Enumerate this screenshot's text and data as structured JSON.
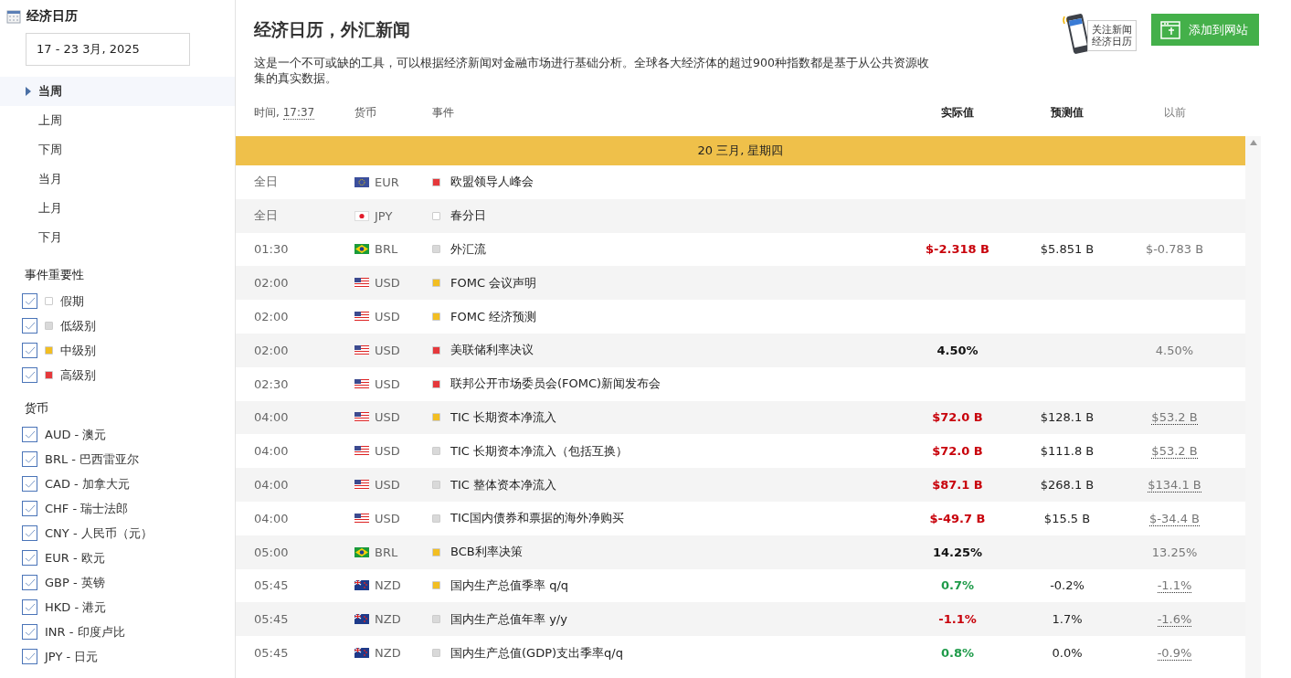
{
  "sidebar": {
    "title": "经济日历",
    "date_range": "17  - 23 3月, 2025",
    "periods": [
      {
        "label": "当周",
        "selected": true
      },
      {
        "label": "上周",
        "selected": false
      },
      {
        "label": "下周",
        "selected": false
      },
      {
        "label": "当月",
        "selected": false
      },
      {
        "label": "上月",
        "selected": false
      },
      {
        "label": "下月",
        "selected": false
      }
    ],
    "importance_title": "事件重要性",
    "importance": [
      {
        "label": "假期",
        "checked": true,
        "color": "#ffffff"
      },
      {
        "label": "低级别",
        "checked": true,
        "color": "#d9d9d9"
      },
      {
        "label": "中级别",
        "checked": true,
        "color": "#f2be22"
      },
      {
        "label": "高级别",
        "checked": true,
        "color": "#e5383b"
      }
    ],
    "currency_title": "货币",
    "currencies": [
      {
        "label": "AUD - 澳元",
        "checked": true
      },
      {
        "label": "BRL - 巴西雷亚尔",
        "checked": true
      },
      {
        "label": "CAD - 加拿大元",
        "checked": true
      },
      {
        "label": "CHF - 瑞士法郎",
        "checked": true
      },
      {
        "label": "CNY - 人民币（元）",
        "checked": true
      },
      {
        "label": "EUR - 欧元",
        "checked": true
      },
      {
        "label": "GBP - 英镑",
        "checked": true
      },
      {
        "label": "HKD - 港元",
        "checked": true
      },
      {
        "label": "INR - 印度卢比",
        "checked": true
      },
      {
        "label": "JPY - 日元",
        "checked": true
      }
    ]
  },
  "header": {
    "title": "经济日历，外汇新闻",
    "description": "这是一个不可或缺的工具，可以根据经济新闻对金融市场进行基础分析。全球各大经济体的超过900种指数都是基于从公共资源收集的真实数据。",
    "follow_button": [
      "关注新闻",
      "经济日历"
    ],
    "add_button": "添加到网站"
  },
  "table": {
    "time_label": "时间,",
    "time_value": "17:37",
    "columns": [
      "货币",
      "事件",
      "实际值",
      "预测值",
      "以前"
    ],
    "day": "20 三月, 星期四",
    "rows": [
      {
        "time": "全日",
        "kind": "eu",
        "currency": "EUR",
        "color": "#e5383b",
        "event": "欧盟领导人峰会"
      },
      {
        "time": "全日",
        "kind": "jp",
        "currency": "JPY",
        "color": "#ffffff",
        "event": "春分日"
      },
      {
        "time": "01:30",
        "kind": "br",
        "currency": "BRL",
        "color": "#d9d9d9",
        "event": "外汇流",
        "actual": "$-2.318 B",
        "better": false,
        "worse": true,
        "forecast": "$5.851 B",
        "previous": "$-0.783 B",
        "revised": false
      },
      {
        "time": "02:00",
        "kind": "us",
        "currency": "USD",
        "color": "#f2be22",
        "event": "FOMC 会议声明"
      },
      {
        "time": "02:00",
        "kind": "us",
        "currency": "USD",
        "color": "#f2be22",
        "event": "FOMC 经济预测"
      },
      {
        "time": "02:00",
        "kind": "us",
        "currency": "USD",
        "color": "#e5383b",
        "event": "美联储利率决议",
        "actual": "4.50%",
        "better": false,
        "worse": false,
        "previous": "4.50%",
        "revised": false
      },
      {
        "time": "02:30",
        "kind": "us",
        "currency": "USD",
        "color": "#e5383b",
        "event": "联邦公开市场委员会(FOMC)新闻发布会"
      },
      {
        "time": "04:00",
        "kind": "us",
        "currency": "USD",
        "color": "#f2be22",
        "event": "TIC 长期资本净流入",
        "actual": "$72.0 B",
        "better": false,
        "worse": true,
        "forecast": "$128.1 B",
        "previous": "$53.2 B",
        "revised": true
      },
      {
        "time": "04:00",
        "kind": "us",
        "currency": "USD",
        "color": "#d9d9d9",
        "event": "TIC 长期资本净流入（包括互换）",
        "actual": "$72.0 B",
        "better": false,
        "worse": true,
        "forecast": "$111.8 B",
        "previous": "$53.2 B",
        "revised": true
      },
      {
        "time": "04:00",
        "kind": "us",
        "currency": "USD",
        "color": "#d9d9d9",
        "event": "TIC 整体资本净流入",
        "actual": "$87.1 B",
        "better": false,
        "worse": true,
        "forecast": "$268.1 B",
        "previous": "$134.1 B",
        "revised": true
      },
      {
        "time": "04:00",
        "kind": "us",
        "currency": "USD",
        "color": "#d9d9d9",
        "event": "TIC国内债券和票据的海外净购买",
        "actual": "$-49.7 B",
        "better": false,
        "worse": true,
        "forecast": "$15.5 B",
        "previous": "$-34.4 B",
        "revised": true
      },
      {
        "time": "05:00",
        "kind": "br",
        "currency": "BRL",
        "color": "#f2be22",
        "event": "BCB利率决策",
        "actual": "14.25%",
        "better": false,
        "worse": false,
        "previous": "13.25%",
        "revised": false
      },
      {
        "time": "05:45",
        "kind": "nz",
        "currency": "NZD",
        "color": "#f2be22",
        "event": "国内生产总值季率 q/q",
        "actual": "0.7%",
        "better": true,
        "worse": false,
        "forecast": "-0.2%",
        "previous": "-1.1%",
        "revised": true
      },
      {
        "time": "05:45",
        "kind": "nz",
        "currency": "NZD",
        "color": "#d9d9d9",
        "event": "国内生产总值年率 y/y",
        "actual": "-1.1%",
        "better": false,
        "worse": true,
        "forecast": "1.7%",
        "previous": "-1.6%",
        "revised": true
      },
      {
        "time": "05:45",
        "kind": "nz",
        "currency": "NZD",
        "color": "#d9d9d9",
        "event": "国内生产总值(GDP)支出季率q/q",
        "actual": "0.8%",
        "better": true,
        "worse": false,
        "forecast": "0.0%",
        "previous": "-0.9%",
        "revised": true
      }
    ]
  }
}
